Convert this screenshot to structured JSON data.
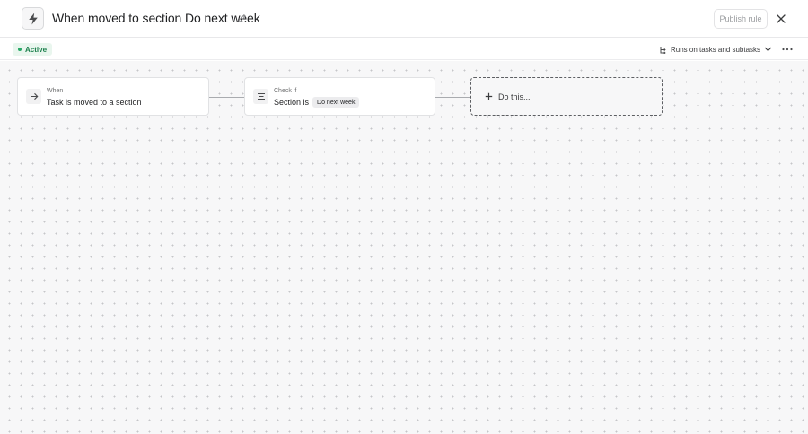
{
  "header": {
    "rule_icon": "lightning-bolt-icon",
    "title": "When moved to section Do next week",
    "edit_icon": "pencil-icon",
    "publish_label": "Publish rule",
    "close_icon": "close-icon"
  },
  "subbar": {
    "status": "Active",
    "status_color": "#27a866",
    "runs_on": "Runs on tasks and subtasks",
    "runs_on_icon": "subtask-icon",
    "more_icon": "more-horizontal-icon"
  },
  "canvas": {
    "trigger": {
      "icon": "arrow-right-icon",
      "kicker": "When",
      "text": "Task is moved to a section"
    },
    "condition": {
      "icon": "lines-icon",
      "kicker": "Check if",
      "text": "Section is",
      "chip": "Do next week"
    },
    "action": {
      "icon": "plus-icon",
      "label": "Do this..."
    }
  }
}
